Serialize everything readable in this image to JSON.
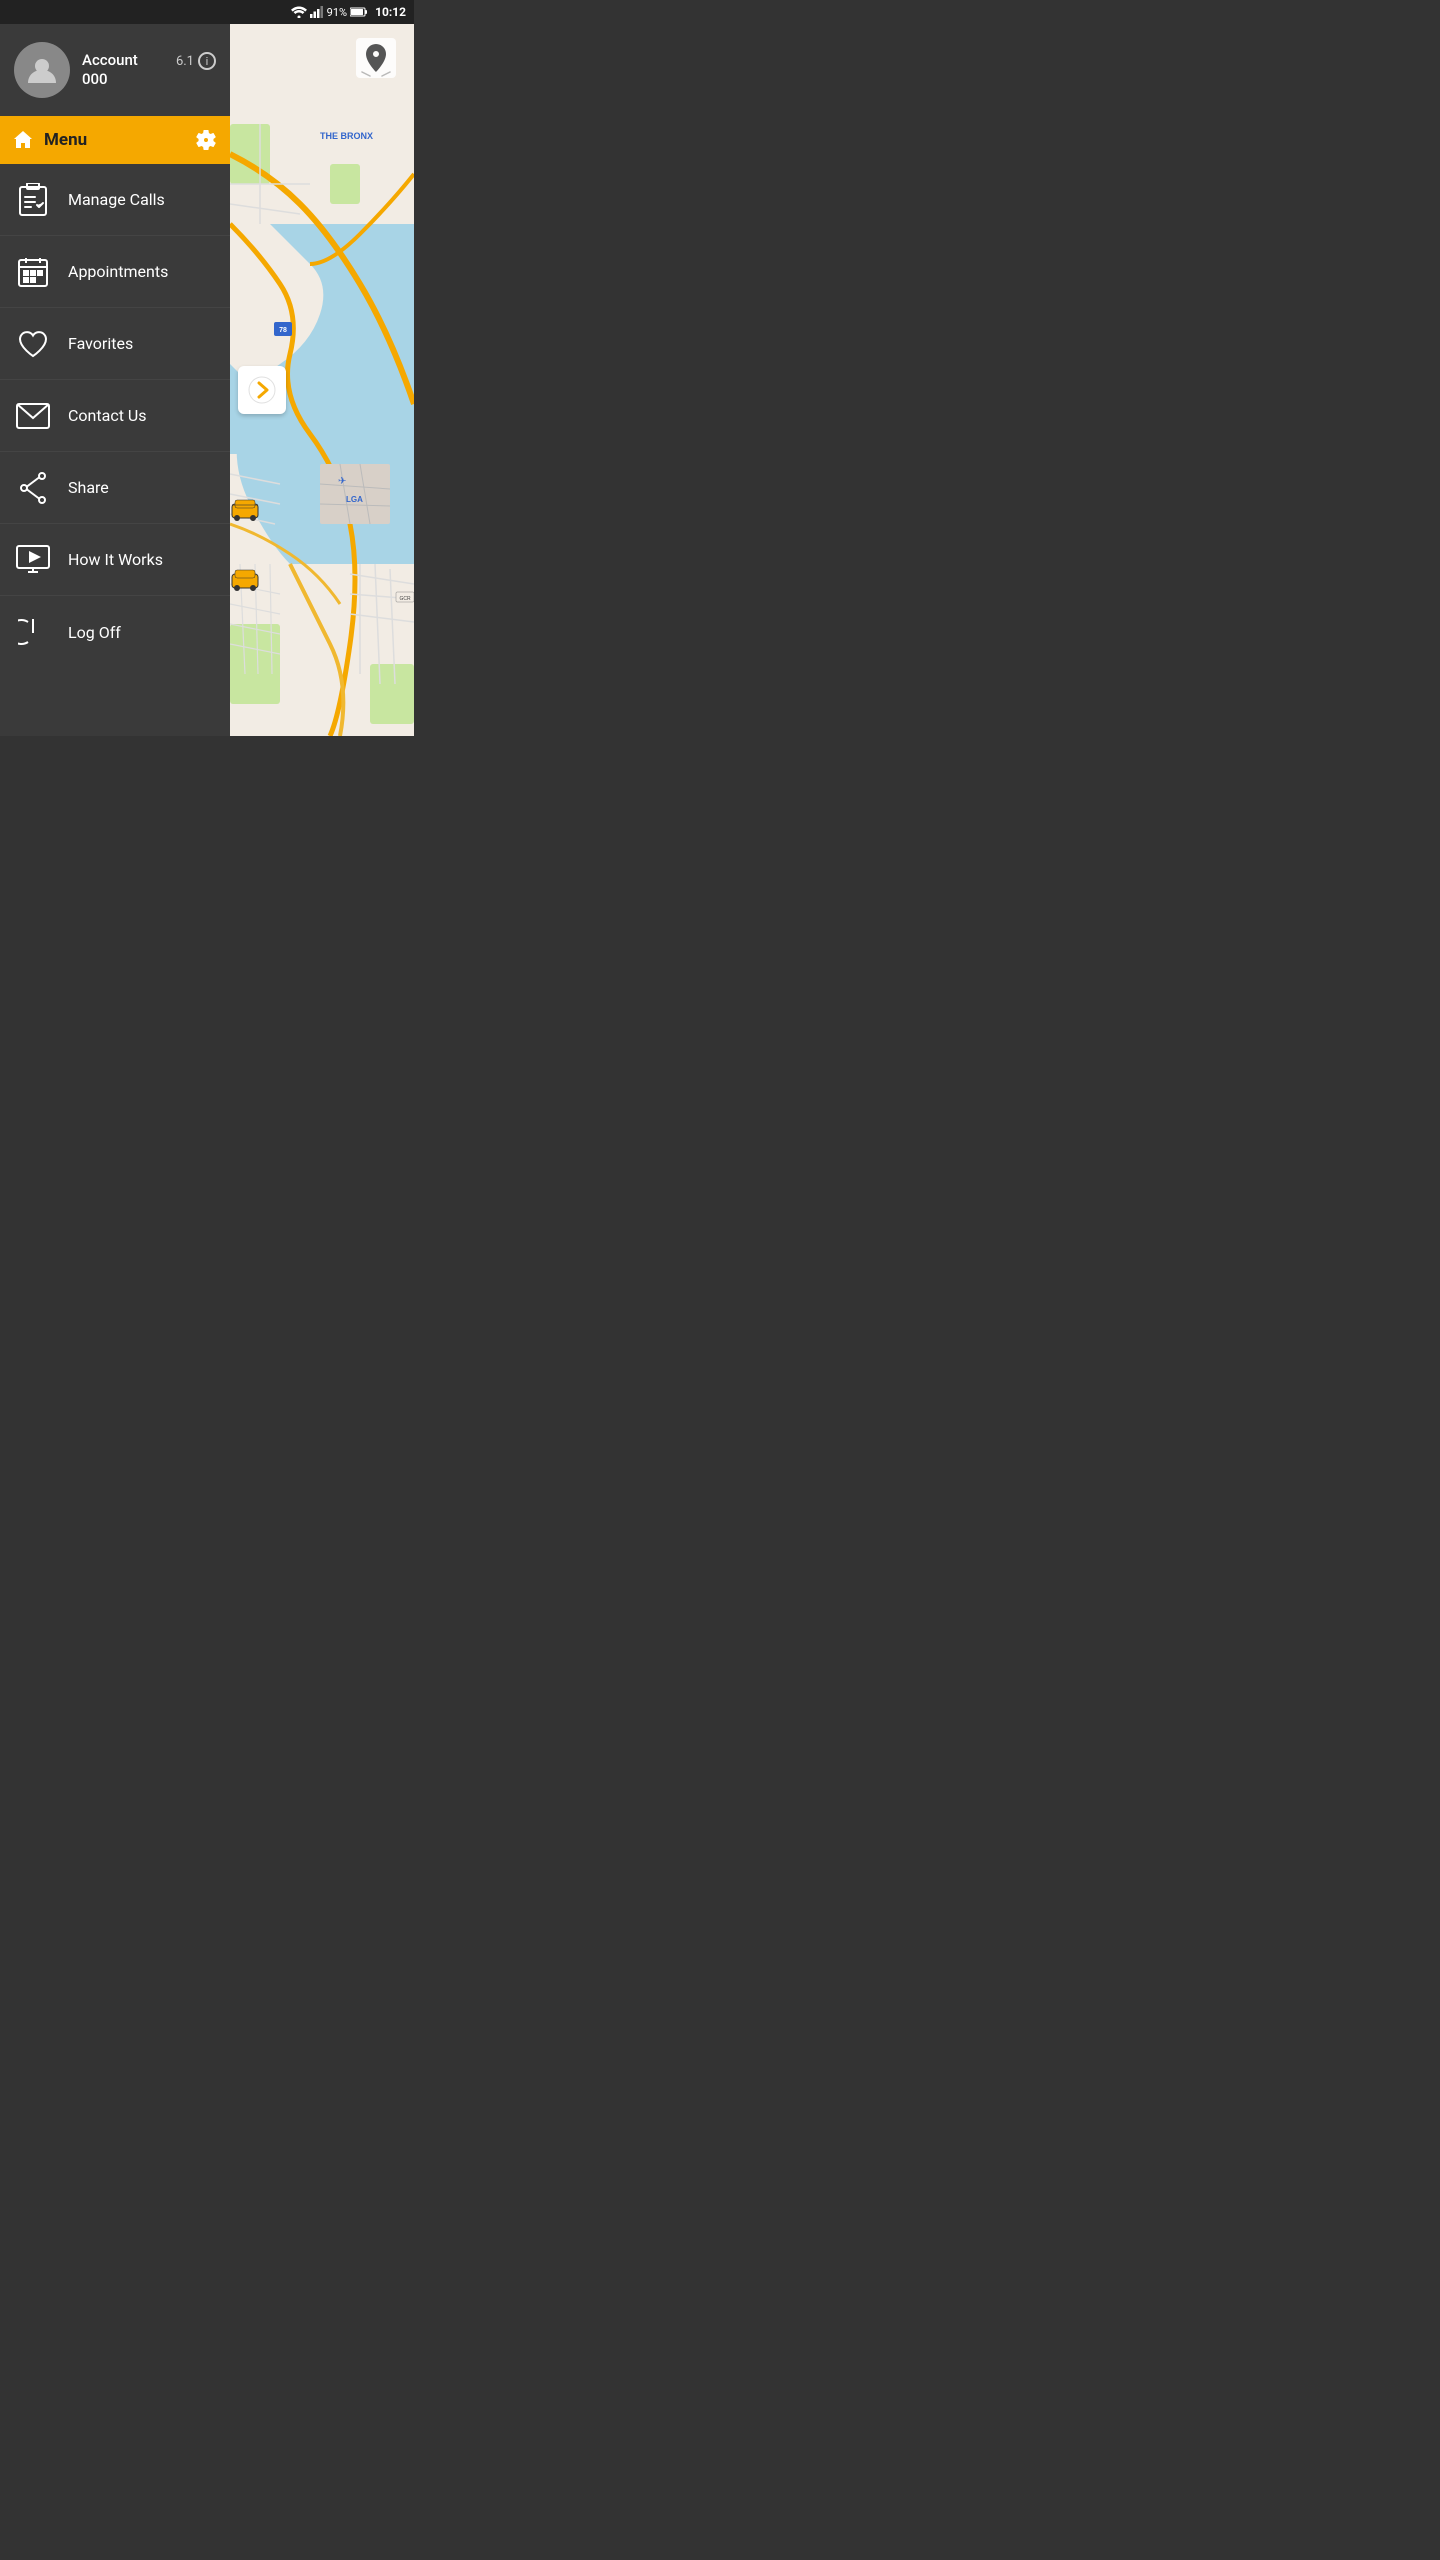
{
  "statusBar": {
    "battery": "91%",
    "time": "10:12"
  },
  "account": {
    "name": "Account",
    "number": "000",
    "version": "6.1"
  },
  "menu": {
    "title": "Menu",
    "items": [
      {
        "id": "manage-calls",
        "label": "Manage Calls"
      },
      {
        "id": "appointments",
        "label": "Appointments"
      },
      {
        "id": "favorites",
        "label": "Favorites"
      },
      {
        "id": "contact-us",
        "label": "Contact Us"
      },
      {
        "id": "share",
        "label": "Share"
      },
      {
        "id": "how-it-works",
        "label": "How It Works"
      },
      {
        "id": "log-off",
        "label": "Log Off"
      }
    ]
  },
  "map": {
    "area": "New York - The Bronx, LGA area"
  }
}
